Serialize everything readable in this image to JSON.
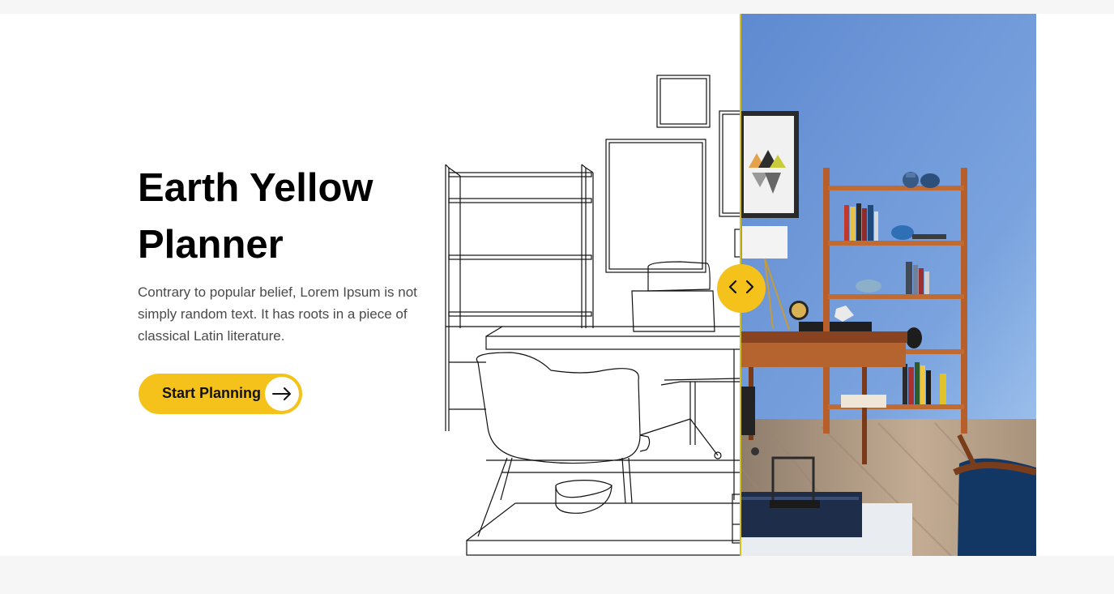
{
  "hero": {
    "title_line1": "Earth Yellow",
    "title_line2": "Planner",
    "description": "Contrary to popular belief, Lorem Ipsum is not simply random text. It has roots in a piece of classical Latin literature.",
    "cta_label": "Start Planning"
  },
  "colors": {
    "accent": "#f5c21b",
    "wall_blue": "#6b93d0",
    "wood": "#b8602a",
    "floor": "#b59b80"
  },
  "icons": {
    "cta": "arrow-right-icon",
    "handle": "chevron-left-right-icon"
  }
}
